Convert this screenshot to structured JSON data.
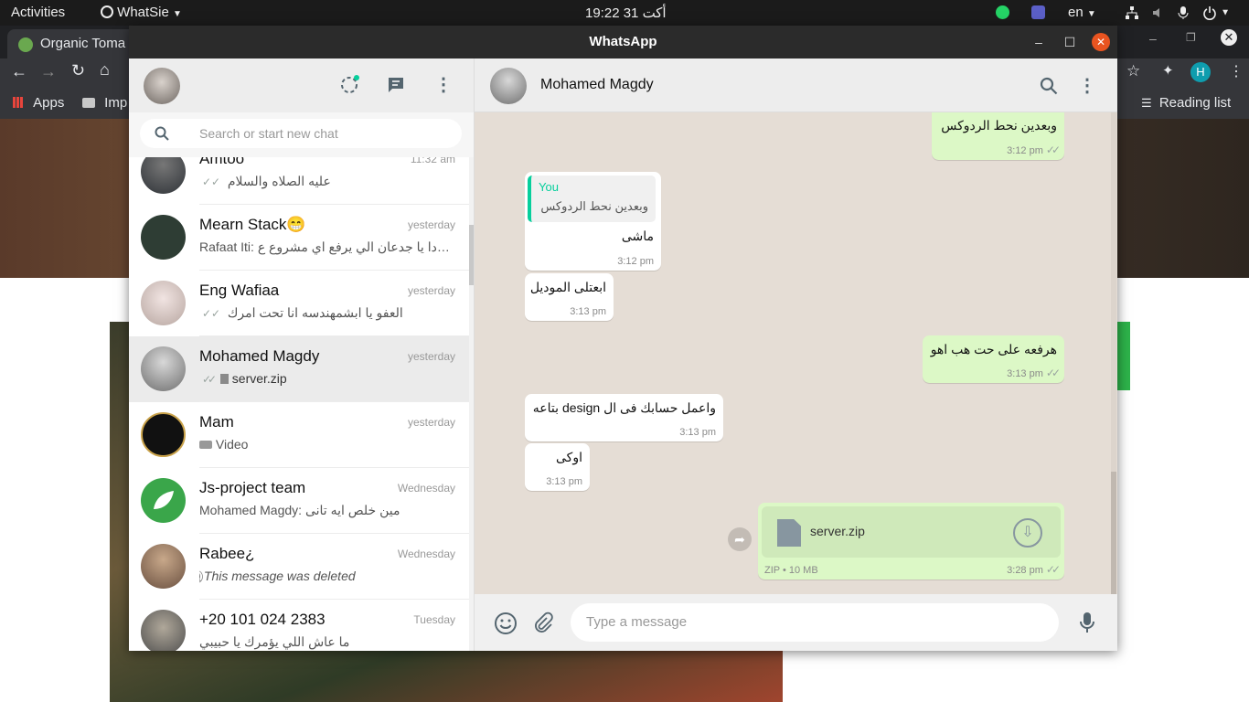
{
  "topbar": {
    "activities": "Activities",
    "app_name": "WhatSie",
    "clock": "19:22  31 أكت",
    "language": "en"
  },
  "browser": {
    "tab_title": "Organic Toma",
    "bookmarks": {
      "apps": "Apps",
      "imp": "Imp",
      "reading_list": "Reading list"
    },
    "profile_initial": "H"
  },
  "window": {
    "title": "WhatsApp"
  },
  "search": {
    "placeholder": "Search or start new chat"
  },
  "chats": [
    {
      "name": "Amtoo",
      "time": "11:32 am",
      "preview": "عليه الصلاه والسلام",
      "ticks": true,
      "avatar_color": "#3a3f44"
    },
    {
      "name": "Mearn Stack😁",
      "time": "yesterday",
      "preview": "Rafaat Iti: دا يا جدعان الي يرفع اي مشروع ع…",
      "ticks": false,
      "avatar_color": "#2e3d34"
    },
    {
      "name": "Eng Wafiaa",
      "time": "yesterday",
      "preview": "العفو يا ابشمهندسه انا تحت امرك",
      "ticks": true,
      "avatar_color": "#c9b9ad"
    },
    {
      "name": "Mohamed Magdy",
      "time": "yesterday",
      "preview": "server.zip",
      "ticks": true,
      "file": true,
      "avatar_color": "#8c8c8c",
      "active": true
    },
    {
      "name": "Mam",
      "time": "yesterday",
      "preview": "Video",
      "ticks": false,
      "video": true,
      "avatar_color": "#111111"
    },
    {
      "name": "Js-project team",
      "time": "Wednesday",
      "preview": "Mohamed Magdy: مين خلص ايه تانى",
      "ticks": false,
      "avatar_color": "#3aa64a"
    },
    {
      "name": "Rabee¿",
      "time": "Wednesday",
      "preview": "This message was deleted",
      "ticks": false,
      "deleted": true,
      "avatar_color": "#a88a70"
    },
    {
      "name": "+20 101 024 2383",
      "time": "Tuesday",
      "preview": "ما عاش اللي يؤمرك يا حبيبي",
      "ticks": false,
      "avatar_color": "#6d6d6d"
    }
  ],
  "conversation": {
    "contact_name": "Mohamed Magdy",
    "messages": [
      {
        "dir": "out",
        "text": "وبعدين نحط الردوكس",
        "time": "3:12 pm",
        "ticks": true
      },
      {
        "dir": "in",
        "quote_author": "You",
        "quote_text": "وبعدين نحط الردوكس",
        "text": "ماشى",
        "time": "3:12 pm"
      },
      {
        "dir": "in",
        "text": "ابعتلى الموديل",
        "time": "3:13 pm"
      },
      {
        "dir": "out",
        "text": "هرفعه على حت هب اهو",
        "time": "3:13 pm",
        "ticks": true
      },
      {
        "dir": "in",
        "text": "واعمل حسابك فى ال design بتاعه",
        "time": "3:13 pm"
      },
      {
        "dir": "in",
        "text": "اوكى",
        "time": "3:13 pm"
      },
      {
        "dir": "out",
        "file_name": "server.zip",
        "file_meta": "ZIP • 10 MB",
        "time": "3:28 pm",
        "ticks": true
      }
    ]
  },
  "composer": {
    "placeholder": "Type a message"
  },
  "colors": {
    "accent_green": "#06cf9c",
    "bubble_out": "#dcf8c6",
    "close_button": "#e95420"
  }
}
